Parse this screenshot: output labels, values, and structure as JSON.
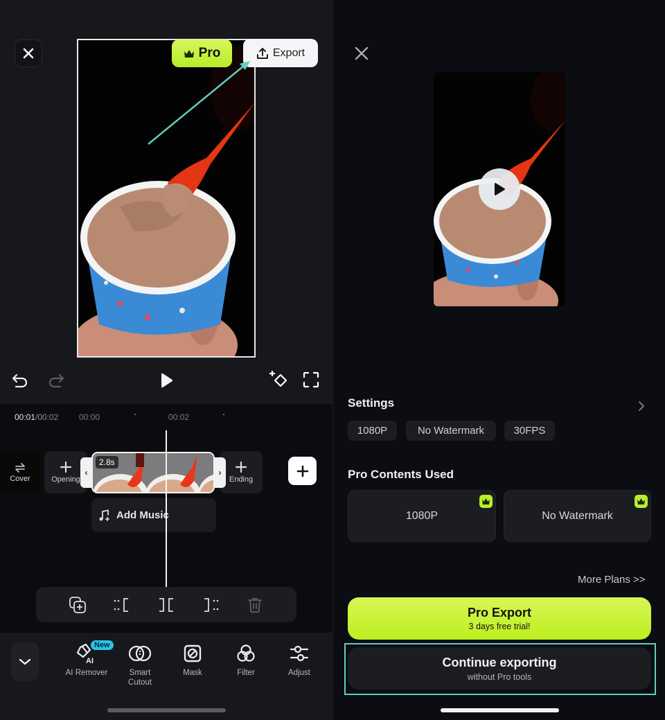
{
  "editor": {
    "pro_label": "Pro",
    "export_label": "Export",
    "time_current": "00:01",
    "time_total": "/00:02",
    "ticks": [
      "00:00",
      "00:02"
    ],
    "cover_label": "Cover",
    "opening_label": "Opening",
    "ending_label": "Ending",
    "clip_duration": "2.8s",
    "add_music_label": "Add Music",
    "new_badge": "New",
    "tools": [
      {
        "label": "AI Remover",
        "icon": "eraser-ai-icon"
      },
      {
        "label": "Smart Cutout",
        "icon": "smart-cutout-icon"
      },
      {
        "label": "Mask",
        "icon": "mask-icon"
      },
      {
        "label": "Filter",
        "icon": "filter-icon"
      },
      {
        "label": "Adjust",
        "icon": "adjust-sliders-icon"
      }
    ],
    "colors": {
      "pro_accent": "#c3f23a",
      "annotation": "#5fcfc0"
    }
  },
  "export_dialog": {
    "settings_title": "Settings",
    "settings_chips": [
      "1080P",
      "No Watermark",
      "30FPS"
    ],
    "pro_contents_title": "Pro Contents Used",
    "pro_contents": [
      "1080P",
      "No Watermark"
    ],
    "more_plans": "More Plans >>",
    "pro_export_title": "Pro Export",
    "pro_export_sub": "3 days free trial!",
    "continue_title": "Continue exporting",
    "continue_sub": "without Pro tools"
  }
}
